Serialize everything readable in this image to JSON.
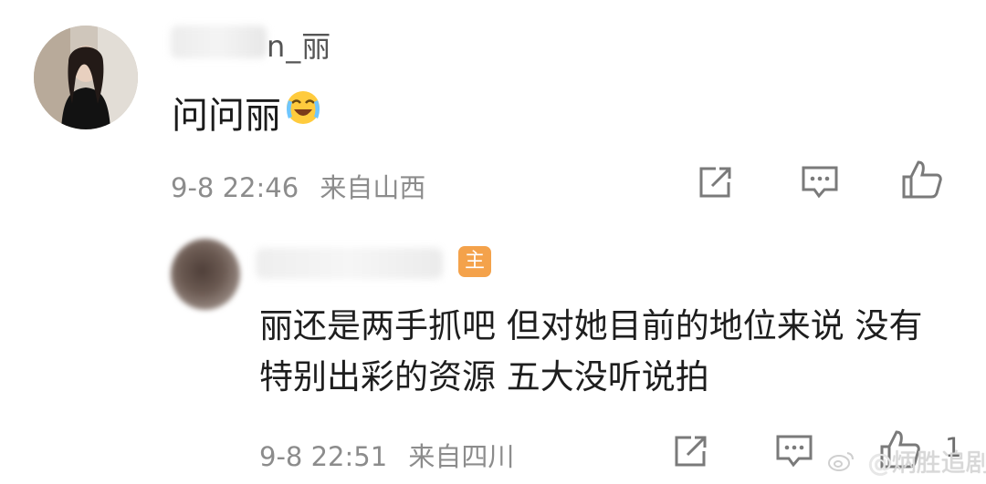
{
  "comment": {
    "username_visible": "n_丽",
    "text": "问问丽",
    "emoji": "laughing-crying-emoji",
    "time": "9-8 22:46",
    "location": "来自山西"
  },
  "reply": {
    "author_badge": "主",
    "text": "丽还是两手抓吧 但对她目前的地位来说 没有特别出彩的资源 五大没听说拍",
    "time": "9-8 22:51",
    "location": "来自四川",
    "like_count": "1"
  },
  "watermark": {
    "text": "炳胜追剧"
  },
  "icons": {
    "share": "share-icon",
    "comment": "comment-icon",
    "like": "like-icon",
    "weibo": "weibo-logo-icon"
  },
  "colors": {
    "meta": "#8c8c8c",
    "badge": "#f4a24b",
    "icon": "#7a7a7a"
  }
}
